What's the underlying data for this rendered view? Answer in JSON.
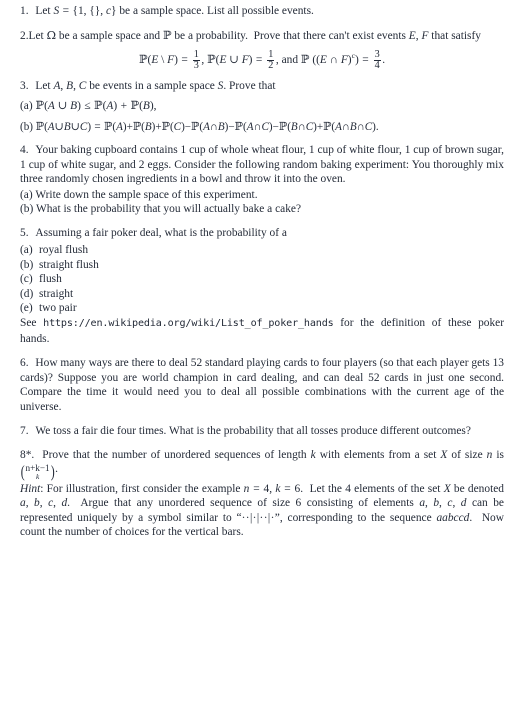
{
  "document": {
    "type": "probability-problem-set",
    "background_color": "#ffffff",
    "text_color": "#242b38",
    "problems": [
      {
        "number": "1.",
        "text_before": "Let ",
        "math_inline": "S = {1, {}, c}",
        "text_after": " be a sample space. List all possible events."
      },
      {
        "number": "2.",
        "line1": "Let Ω be a sample space and ℙ be a probability.  Prove that there can't exist",
        "line2": "events E, F that satisfy",
        "display": {
          "eq1_lhs": "ℙ(E \\ F) =",
          "eq1_num": "1",
          "eq1_den": "3",
          "sep1": ",",
          "eq2_lhs": "ℙ(E ∪ F) =",
          "eq2_num": "1",
          "eq2_den": "2",
          "sep2": ", and",
          "eq3_lhs": "ℙ ((E ∩ F)ᶜ) =",
          "eq3_num": "3",
          "eq3_den": "4",
          "period": "."
        }
      },
      {
        "number": "3.",
        "text": "Let A, B, C be events in a sample space S. Prove that",
        "parts": [
          {
            "label": "(a)",
            "math": "ℙ(A ∪ B) ≤ ℙ(A) + ℙ(B),"
          },
          {
            "label": "(b)",
            "math": "ℙ(A∪B∪C) = ℙ(A)+ℙ(B)+ℙ(C)−ℙ(A∩B)−ℙ(A∩C)−ℙ(B∩C)+ℙ(A∩B∩C)."
          }
        ]
      },
      {
        "number": "4.",
        "text": "Your baking cupboard contains 1 cup of whole wheat flour, 1 cup of white flour, 1 cup of brown sugar, 1 cup of white sugar, and 2 eggs.  Consider the following random baking experiment: You thoroughly mix three randomly chosen ingredients in a bowl and throw it into the oven.",
        "parts": [
          {
            "label": "(a)",
            "text": "Write down the sample space of this experiment."
          },
          {
            "label": "(b)",
            "text": "What is the probability that you will actually bake a cake?"
          }
        ]
      },
      {
        "number": "5.",
        "text": "Assuming a fair poker deal, what is the probability of a",
        "parts": [
          {
            "label": "(a)",
            "text": "royal flush"
          },
          {
            "label": "(b)",
            "text": "straight flush"
          },
          {
            "label": "(c)",
            "text": "flush"
          },
          {
            "label": "(d)",
            "text": "straight"
          },
          {
            "label": "(e)",
            "text": "two pair"
          }
        ],
        "reference_prefix": "See ",
        "reference_url": "https://en.wikipedia.org/wiki/List_of_poker_hands",
        "reference_suffix": " for the definition of these poker hands."
      },
      {
        "number": "6.",
        "text": "How many ways are there to deal 52 standard playing cards to four players (so that each player gets 13 cards)? Suppose you are world champion in card dealing, and can deal 52 cards in just one second.  Compare the time it would need you to deal all possible combinations with the current age of the universe."
      },
      {
        "number": "7.",
        "text": "We toss a fair die four times.  What is the probability that all tosses produce different outcomes?"
      },
      {
        "number": "8*.",
        "text_part1": "Prove that the number of unordered sequences of length ",
        "var_k": "k",
        "text_part2": " with elements from a set ",
        "var_X": "X",
        "text_part3": " of size ",
        "var_n": "n",
        "text_part4": " is ",
        "binom_top": "n+k−1",
        "binom_bottom": "k",
        "text_part5": ".",
        "hint_label": "Hint",
        "hint_text": ": For illustration, first consider the example n = 4, k = 6.  Let the 4 elements of the set X be denoted a, b, c, d.  Argue that any unordered sequence of size 6 consisting of elements a, b, c, d can be represented uniquely by a symbol similar to “··|·|··|·”, corresponding to the sequence aabccd.  Now count the number of choices for the vertical bars.",
        "hint_symbol": "··|·|··|·",
        "hint_sequence": "aabccd"
      }
    ]
  }
}
